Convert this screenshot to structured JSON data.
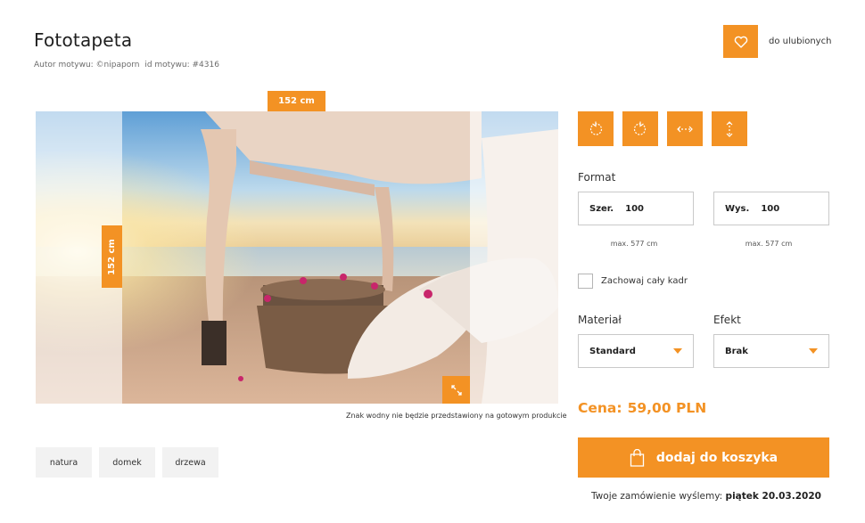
{
  "product": {
    "title": "Fototapeta",
    "author": "Autor motywu: ©nipaporn",
    "motif_id": "id motywu: #4316"
  },
  "favorites": {
    "label": "do ulubionych",
    "icon": "heart-icon"
  },
  "preview": {
    "width_badge": "152 cm",
    "height_badge": "152 cm",
    "watermark_note": "Znak wodny nie będzie przedstawiony na gotowym produkcie"
  },
  "tags": [
    "natura",
    "domek",
    "drzewa"
  ],
  "tools": [
    {
      "icon": "rotate-left-icon"
    },
    {
      "icon": "rotate-right-icon"
    },
    {
      "icon": "flip-horizontal-icon"
    },
    {
      "icon": "flip-vertical-icon"
    }
  ],
  "format": {
    "label": "Format",
    "width": {
      "label": "Szer.",
      "value": "100",
      "hint": "max. 577 cm"
    },
    "height": {
      "label": "Wys.",
      "value": "100",
      "hint": "max. 577 cm"
    },
    "keep_frame": {
      "label": "Zachowaj cały kadr",
      "checked": false
    }
  },
  "material": {
    "label": "Materiał",
    "selected": "Standard"
  },
  "effect": {
    "label": "Efekt",
    "selected": "Brak"
  },
  "price": {
    "label": "Cena:",
    "value": "59,00 PLN"
  },
  "cart": {
    "label": "dodaj do koszyka",
    "icon": "shopping-bag-icon"
  },
  "shipping": {
    "text": "Twoje zamówienie wyślemy:",
    "date": "piątek 20.03.2020"
  },
  "colors": {
    "accent": "#f39224"
  }
}
